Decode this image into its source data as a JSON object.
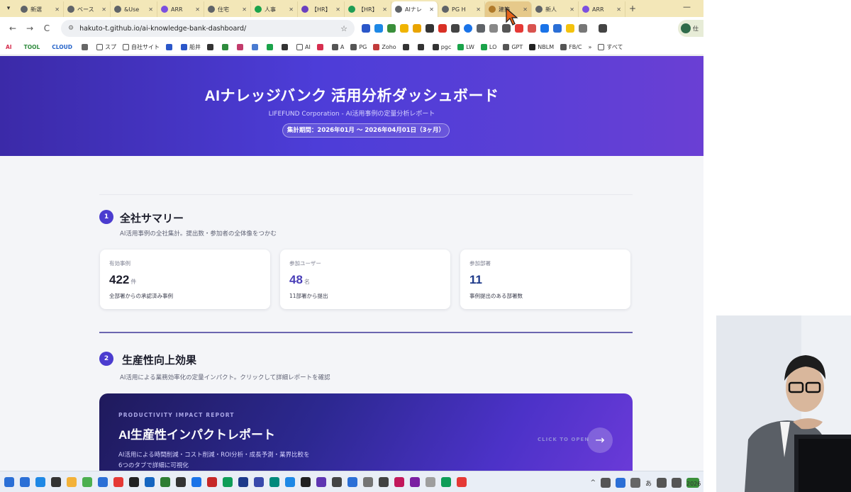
{
  "browser": {
    "tabs": [
      {
        "label": "新選",
        "color": "#5f6368"
      },
      {
        "label": "ベース",
        "color": "#5f6368"
      },
      {
        "label": "&Use",
        "color": "#5f6368"
      },
      {
        "label": "ARR",
        "color": "#7b4fe0"
      },
      {
        "label": "住宅",
        "color": "#5f6368"
      },
      {
        "label": "人事",
        "color": "#1aa34a"
      },
      {
        "label": "【HR】",
        "color": "#6a3fc0"
      },
      {
        "label": "【HR】",
        "color": "#1f9d55"
      },
      {
        "label": "AIナレ",
        "color": "#5f6368",
        "active": true
      },
      {
        "label": "PG H",
        "color": "#5f6368"
      },
      {
        "label": "建築",
        "color": "#b07a2a",
        "hover": true
      },
      {
        "label": "新人",
        "color": "#5f6368"
      },
      {
        "label": "ARR",
        "color": "#7b4fe0"
      }
    ],
    "new_tab": "+",
    "minimize": "—",
    "url": "hakuto-t.github.io/ai-knowledge-bank-dashboard/",
    "profile_text": "仕",
    "nav": {
      "back": "←",
      "forward": "→",
      "reload": "C"
    },
    "bookmarks": [
      {
        "label": "AI",
        "kind": "tag",
        "color": "#d62f4f"
      },
      {
        "label": "TOOL",
        "kind": "tag",
        "color": "#2e8b3d"
      },
      {
        "label": "CLOUD",
        "kind": "tag",
        "color": "#2563c9"
      },
      {
        "label": "",
        "kind": "apps"
      },
      {
        "label": "スプ",
        "kind": "folder"
      },
      {
        "label": "自社サイト",
        "kind": "folder"
      },
      {
        "label": "",
        "kind": "icon",
        "color": "#2b57c9"
      },
      {
        "label": "船井",
        "kind": "icon",
        "color": "#2b57c9"
      },
      {
        "label": "",
        "kind": "icon",
        "color": "#333"
      },
      {
        "label": "",
        "kind": "icon",
        "color": "#2e8b3d"
      },
      {
        "label": "",
        "kind": "icon",
        "color": "#c23b6b"
      },
      {
        "label": "",
        "kind": "icon",
        "color": "#4a7bd1"
      },
      {
        "label": "",
        "kind": "icon",
        "color": "#1aa34a"
      },
      {
        "label": "",
        "kind": "icon",
        "color": "#333"
      },
      {
        "label": "AI",
        "kind": "folder"
      },
      {
        "label": "",
        "kind": "icon",
        "color": "#d62f4f"
      },
      {
        "label": "A",
        "kind": "icon",
        "color": "#555"
      },
      {
        "label": "PG",
        "kind": "icon",
        "color": "#555"
      },
      {
        "label": "Zoho",
        "kind": "icon",
        "color": "#c23b3b"
      },
      {
        "label": "",
        "kind": "icon",
        "color": "#333"
      },
      {
        "label": "",
        "kind": "icon",
        "color": "#333"
      },
      {
        "label": "pgc",
        "kind": "icon",
        "color": "#333"
      },
      {
        "label": "LW",
        "kind": "icon",
        "color": "#1aa34a"
      },
      {
        "label": "LO",
        "kind": "icon",
        "color": "#1aa34a"
      },
      {
        "label": "GPT",
        "kind": "icon",
        "color": "#555"
      },
      {
        "label": "NBLM",
        "kind": "icon",
        "color": "#222"
      },
      {
        "label": "FB/C",
        "kind": "icon",
        "color": "#555"
      },
      {
        "label": "»",
        "kind": "text"
      },
      {
        "label": "すべて",
        "kind": "folder"
      }
    ]
  },
  "page": {
    "title": "AIナレッジバンク 活用分析ダッシュボード",
    "subtitle": "LIFEFUND Corporation - AI活用事例の定量分析レポート",
    "period": "集計期間：2026年01月 〜 2026年04月01日（3ヶ月）"
  },
  "section1": {
    "number": "1",
    "title": "全社サマリー",
    "description": "AI活用事例の全社集計。提出数・参加者の全体像をつかむ",
    "cards": [
      {
        "label": "有効事例",
        "value": "422",
        "unit": "件",
        "note": "全部署からの承認済み事例",
        "color": "#1c1d2b"
      },
      {
        "label": "参加ユーザー",
        "value": "48",
        "unit": "名",
        "note": "11部署から提出",
        "color": "#4a3fb8"
      },
      {
        "label": "参加部署",
        "value": "11",
        "unit": "",
        "note": "事例提出のある部署数",
        "color": "#1e3a8a"
      }
    ]
  },
  "section2": {
    "number": "2",
    "title": "生産性向上効果",
    "description": "AI活用による業務効率化の定量インパクト。クリックして詳細レポートを確認",
    "report": {
      "eyebrow": "PRODUCTIVITY IMPACT REPORT",
      "title": "AI生産性インパクトレポート",
      "description_line1": "AI活用による時間削減・コスト削減・ROI分析・成長予測・業界比較を",
      "description_line2": "6つのタブで詳細に可視化",
      "cta": "CLICK TO OPEN",
      "arrow": "→"
    }
  },
  "taskbar": {
    "apps": [
      "#2b6fd6",
      "#1e88e5",
      "#333333",
      "#f3b23a",
      "#4caf50",
      "#2b6fd6",
      "#e53935",
      "#222222",
      "#1565c0",
      "#2e7d32",
      "#333333",
      "#1a73e8",
      "#c62828",
      "#0f9d58",
      "#1e3a8a",
      "#3949ab",
      "#00897b",
      "#1e88e5",
      "#212121",
      "#5e35b1",
      "#444444",
      "#2b6fd6",
      "#757575",
      "#424242",
      "#c2185b",
      "#7b1fa2",
      "#9e9e9e",
      "#0f9d58",
      "#e53935"
    ],
    "tray_ime": "あ",
    "tray_chevron": "^"
  },
  "webcam": {
    "date_fragment": "2026"
  }
}
